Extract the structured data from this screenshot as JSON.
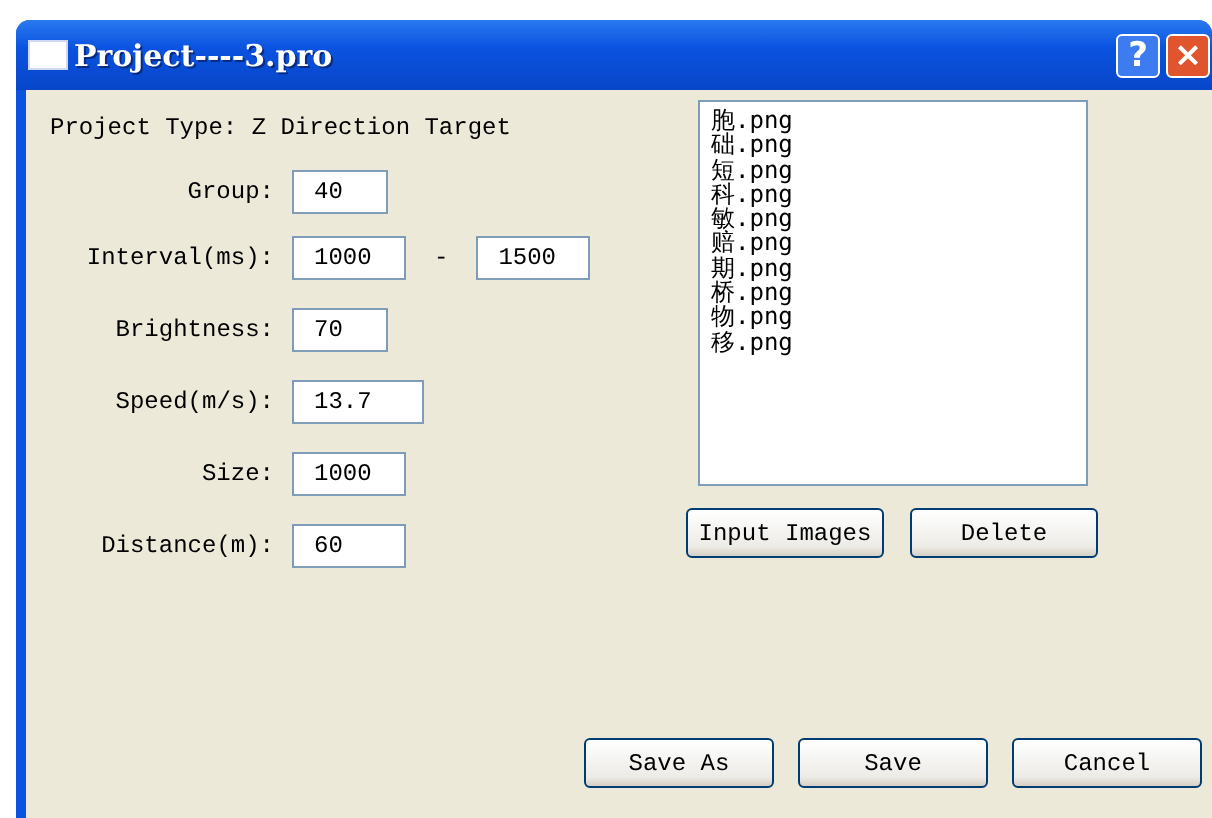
{
  "window": {
    "title": "Project----3.pro",
    "help_button": "?",
    "close_button": "×"
  },
  "project_type": "Project Type: Z Direction Target",
  "fields": [
    {
      "label": "Group:",
      "value": "40"
    },
    {
      "label": "Interval(ms):",
      "value": "1000",
      "value_2": "1500",
      "separator": "-"
    },
    {
      "label": "Brightness:",
      "value": "70"
    },
    {
      "label": "Speed(m/s):",
      "value": "13.7"
    },
    {
      "label": "Size:",
      "value": "1000"
    },
    {
      "label": "Distance(m):",
      "value": "60"
    }
  ],
  "images": [
    "胞.png",
    "础.png",
    "短.png",
    "科.png",
    "敏.png",
    "赔.png",
    "期.png",
    "桥.png",
    "物.png",
    "移.png"
  ],
  "list_buttons": [
    "Input Images",
    "Delete"
  ],
  "buttons": [
    "Save As",
    "Save",
    "Cancel"
  ]
}
